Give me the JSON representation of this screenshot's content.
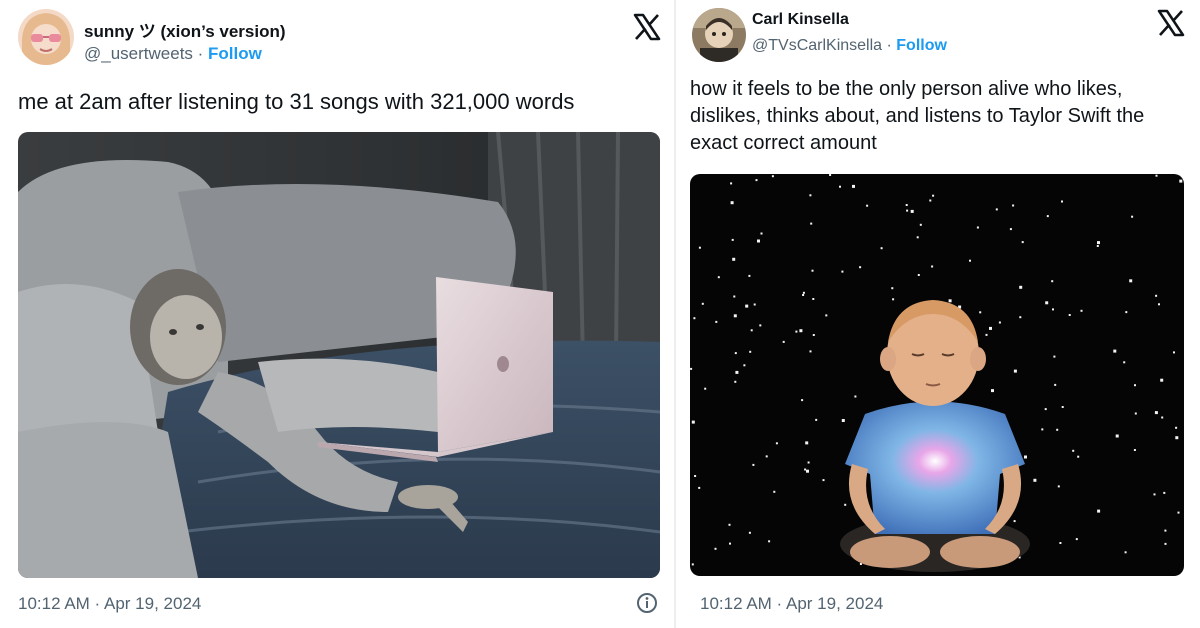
{
  "tweets": [
    {
      "display_name": "sunny ツ (xion’s version)",
      "handle": "@_usertweets",
      "separator": " · ",
      "follow_label": "Follow",
      "text": "me at 2am after listening to 31 songs with 321,000 words",
      "timestamp": "10:12 AM · Apr 19, 2024",
      "media_description": "painting of a woman lying in bed with a laptop",
      "icons": [
        "x-logo-icon",
        "info-icon"
      ]
    },
    {
      "display_name": "Carl Kinsella",
      "handle": "@TVsCarlKinsella",
      "separator": " · ",
      "follow_label": "Follow",
      "text": "how it feels to be the only person alive who likes, dislikes, thinks about, and listens to Taylor Swift the exact correct amount",
      "timestamp": "10:12 AM · Apr 19, 2024",
      "media_description": "cartoon character meditating in space",
      "icons": [
        "x-logo-icon"
      ]
    }
  ],
  "colors": {
    "link": "#1d9bf0",
    "secondary_text": "#536471",
    "primary_text": "#0f1419"
  }
}
